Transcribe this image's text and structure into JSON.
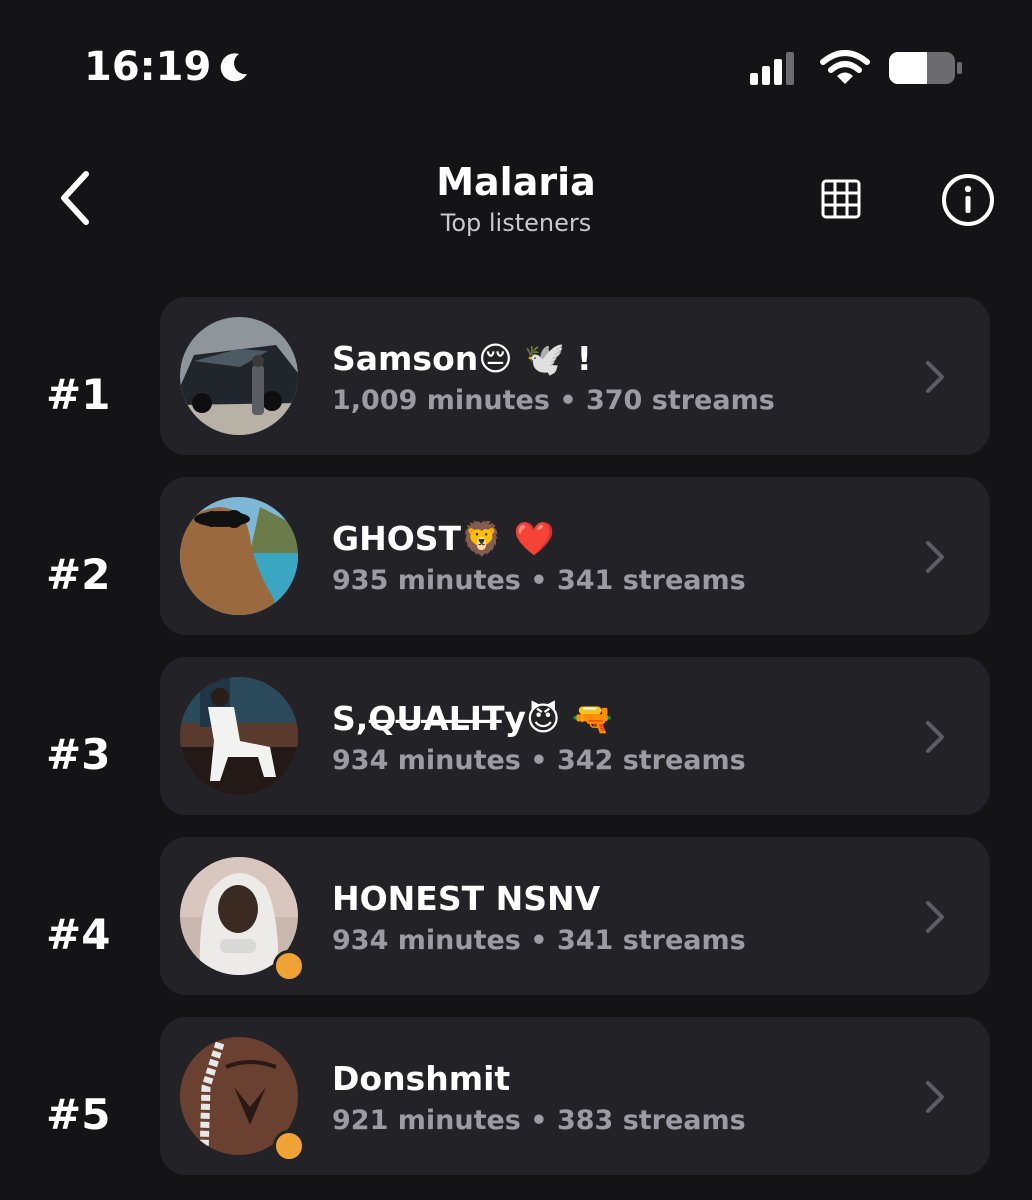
{
  "status_bar": {
    "time": "16:19",
    "icons": [
      "moon-icon",
      "cellular-signal-icon",
      "wifi-icon",
      "battery-icon"
    ]
  },
  "header": {
    "title": "Malaria",
    "subtitle": "Top listeners",
    "icons": [
      "back-chevron-icon",
      "grid-icon",
      "info-icon"
    ]
  },
  "listeners": [
    {
      "rank": "#1",
      "name": "Samson😔 🕊️ !",
      "stats": "1,009 minutes • 370 streams",
      "avatar": "car-photo",
      "online": false
    },
    {
      "rank": "#2",
      "name": "GHOST🦁 ❤️",
      "stats": "935 minutes • 341 streams",
      "avatar": "capybara-sunglasses-photo",
      "online": false
    },
    {
      "rank": "#3",
      "name": "S,Q̶U̶A̶L̶I̶T̶y😈 🔫",
      "stats": "934 minutes • 342 streams",
      "avatar": "man-white-outfit-photo",
      "online": false
    },
    {
      "rank": "#4",
      "name": "HONEST NSNV",
      "stats": "934 minutes • 341 streams",
      "avatar": "man-white-hood-photo",
      "online": true
    },
    {
      "rank": "#5",
      "name": "Donshmit",
      "stats": "921 minutes • 383 streams",
      "avatar": "tattoo-chain-photo",
      "online": true
    }
  ],
  "colors": {
    "background": "#141416",
    "card": "#232327",
    "secondary_text": "#9b9ba1",
    "presence": "#f0a335"
  }
}
